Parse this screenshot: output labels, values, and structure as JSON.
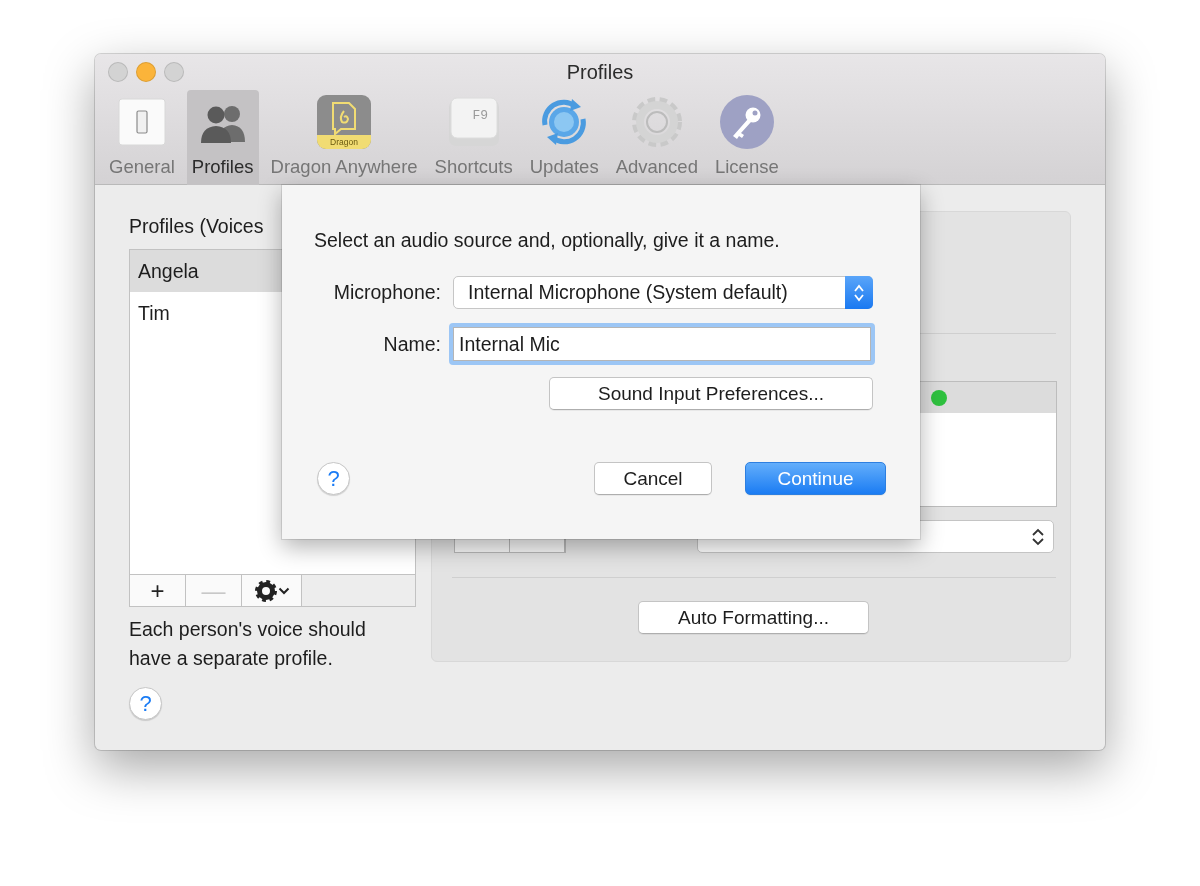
{
  "window": {
    "title": "Profiles",
    "traffic_lights": [
      {
        "color": "#d3d3d3"
      },
      {
        "color": "#fbb43a"
      },
      {
        "color": "#d3d3d3"
      }
    ]
  },
  "toolbar": [
    {
      "label": "General",
      "kind": "switch",
      "selected": false
    },
    {
      "label": "Profiles",
      "kind": "people",
      "selected": true
    },
    {
      "label": "Dragon Anywhere",
      "kind": "dragon",
      "badge": "Dragon",
      "selected": false
    },
    {
      "label": "Shortcuts",
      "kind": "keycap",
      "badge": "F9",
      "selected": false
    },
    {
      "label": "Updates",
      "kind": "sync",
      "selected": false
    },
    {
      "label": "Advanced",
      "kind": "gear",
      "selected": false
    },
    {
      "label": "License",
      "kind": "key",
      "selected": false
    }
  ],
  "profiles_pane": {
    "heading": "Profiles (Voices",
    "profiles": [
      {
        "name": "Angela",
        "selected": true
      },
      {
        "name": "Tim",
        "selected": false
      }
    ],
    "list_buttons": [
      {
        "kind": "add",
        "label": "+",
        "disabled": false
      },
      {
        "kind": "remove",
        "label": "—",
        "disabled": true
      },
      {
        "kind": "gear_menu",
        "disabled": false
      }
    ],
    "hint": "Each person's voice should have a separate profile.",
    "help": "?"
  },
  "settings_group": {
    "status_dot": {
      "color": "#2fc13f"
    },
    "auto_formatting_button": "Auto Formatting..."
  },
  "sheet": {
    "message": "Select an audio source and, optionally, give it a name.",
    "microphone_label": "Microphone:",
    "microphone_value": "Internal Microphone (System default)",
    "name_label": "Name:",
    "name_value": "Internal Mic",
    "sound_prefs_button": "Sound Input Preferences...",
    "help": "?",
    "cancel_button": "Cancel",
    "continue_button": "Continue"
  }
}
